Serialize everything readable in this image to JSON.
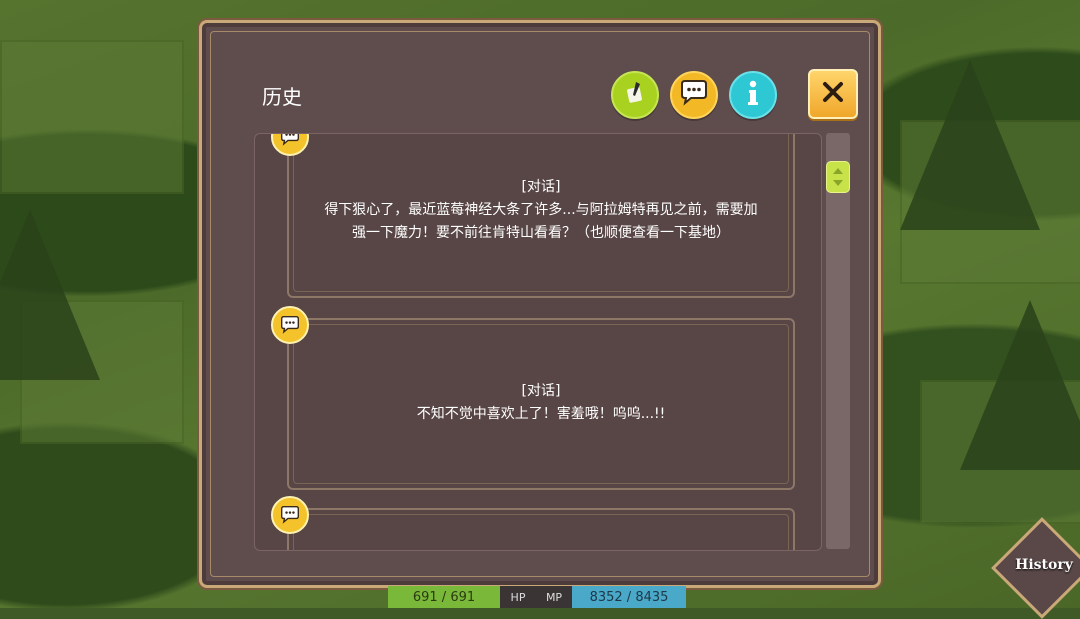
{
  "dialog": {
    "title": "历史",
    "icons": {
      "toggle_text": "quill-icon",
      "dialog_filter": "speech-bubble-icon",
      "info": "info-icon",
      "close": "close-icon"
    }
  },
  "entries": [
    {
      "tag": "[对话]",
      "line1": "得下狠心了，最近蓝莓神经大条了许多...与阿拉姆特再见之前，需要加",
      "line2": "强一下魔力！要不前往肯特山看看？（也顺便查看一下基地）"
    },
    {
      "tag": "[对话]",
      "line1": "不知不觉中喜欢上了！害羞哦！呜呜...!!",
      "line2": ""
    },
    {
      "tag": "",
      "line1": "",
      "line2": ""
    }
  ],
  "hud": {
    "hp_value": "691 / 691",
    "hp_label": "HP",
    "mp_label": "MP",
    "mp_value": "8352 / 8435"
  },
  "history_button": "History",
  "colors": {
    "panel": "#5f4d4d",
    "accent_yellow": "#f2b825",
    "accent_green": "#a8d21f",
    "accent_cyan": "#2ec8d4"
  }
}
